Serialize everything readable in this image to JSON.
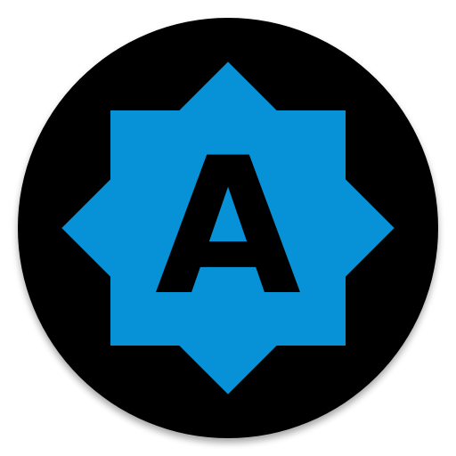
{
  "icon": {
    "letter": "A",
    "icon_name": "star-badge-letter-icon",
    "colors": {
      "background": "#ffffff",
      "circle": "#000000",
      "star": "#0791d6",
      "letter": "#000000"
    }
  }
}
